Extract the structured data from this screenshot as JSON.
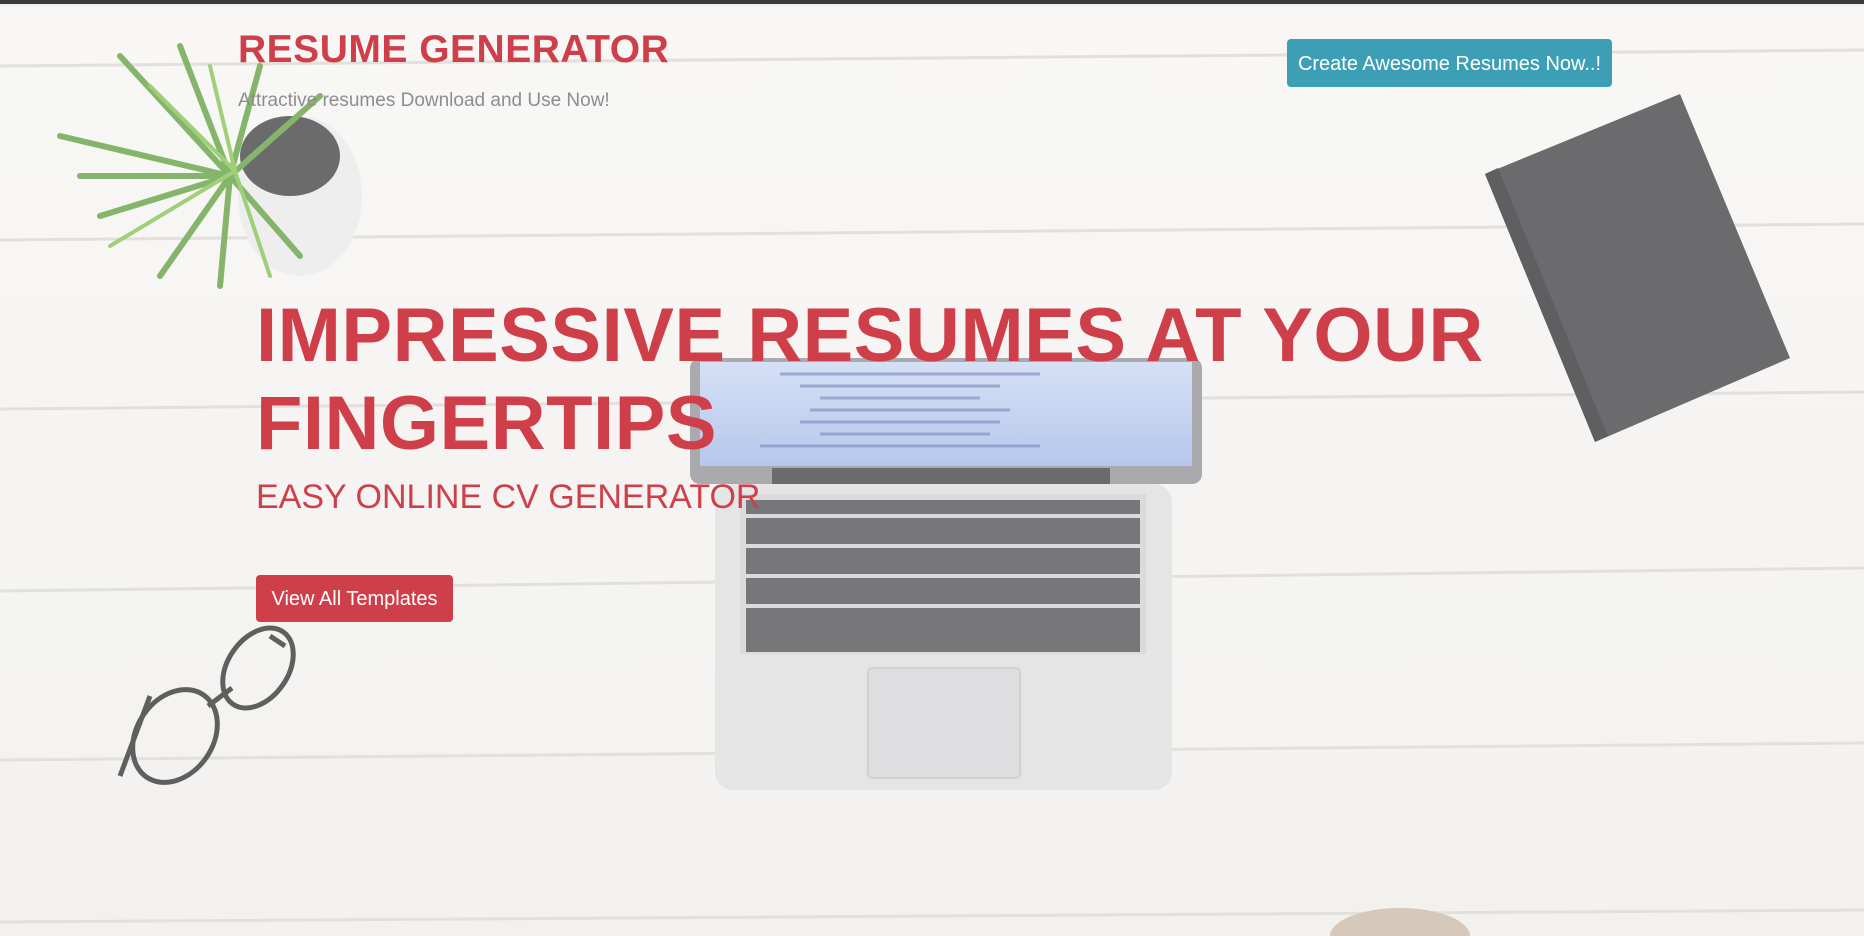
{
  "header": {
    "brand_title": "RESUME GENERATOR",
    "tagline": "Attractive resumes Download and Use Now!",
    "cta_label": "Create Awesome Resumes Now..!"
  },
  "hero": {
    "heading": "IMPRESSIVE RESUMES AT YOUR FINGERTIPS",
    "subheading": "EASY ONLINE CV GENERATOR",
    "button_label": "View All Templates"
  },
  "background": {
    "description_icons": [
      "plant-icon",
      "laptop-icon",
      "notebook-icon",
      "glasses-icon",
      "coffee-cup-icon"
    ]
  },
  "colors": {
    "brand_red": "#cf3f4a",
    "cta_teal": "#3d9fb6",
    "tagline_gray": "#8d8d8d",
    "desk_white": "#f3f1ee"
  }
}
